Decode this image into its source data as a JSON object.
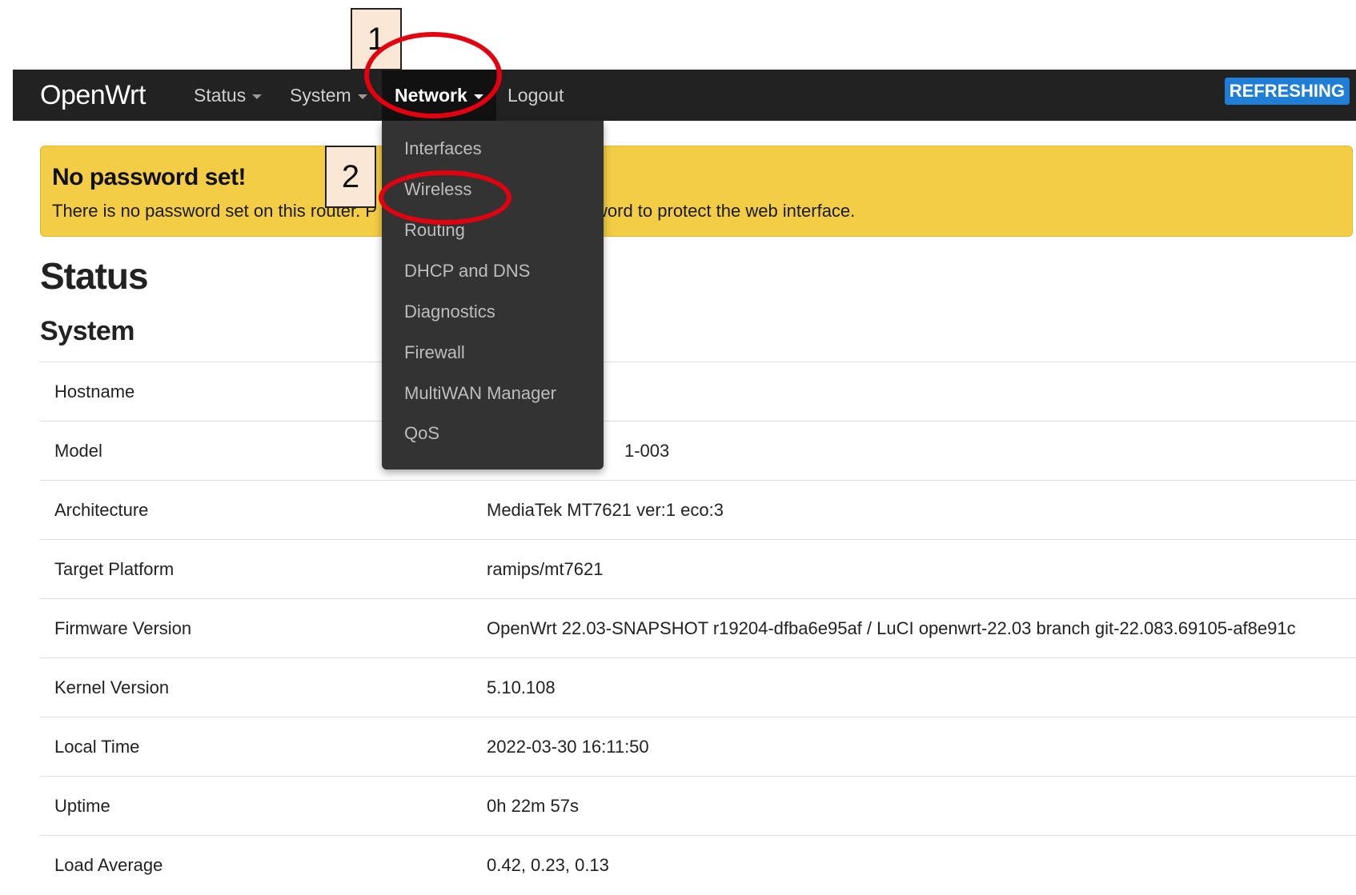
{
  "navbar": {
    "brand": "OpenWrt",
    "items": [
      {
        "label": "Status"
      },
      {
        "label": "System"
      },
      {
        "label": "Network"
      },
      {
        "label": "Logout"
      }
    ],
    "refreshing_badge": "REFRESHING"
  },
  "alert": {
    "title": "No password set!",
    "text_left": "There is no password set on this router. P",
    "text_right": "word to protect the web interface."
  },
  "page": {
    "title": "Status",
    "section": "System"
  },
  "system_table": [
    {
      "key": "Hostname",
      "value": ""
    },
    {
      "key": "Model",
      "value": "1-003"
    },
    {
      "key": "Architecture",
      "value": "MediaTek MT7621 ver:1 eco:3"
    },
    {
      "key": "Target Platform",
      "value": "ramips/mt7621"
    },
    {
      "key": "Firmware Version",
      "value": "OpenWrt 22.03-SNAPSHOT r19204-dfba6e95af / LuCI openwrt-22.03 branch git-22.083.69105-af8e91c"
    },
    {
      "key": "Kernel Version",
      "value": "5.10.108"
    },
    {
      "key": "Local Time",
      "value": "2022-03-30 16:11:50"
    },
    {
      "key": "Uptime",
      "value": "0h 22m 57s"
    },
    {
      "key": "Load Average",
      "value": "0.42, 0.23, 0.13"
    }
  ],
  "network_menu": [
    "Interfaces",
    "Wireless",
    "Routing",
    "DHCP and DNS",
    "Diagnostics",
    "Firewall",
    "MultiWAN Manager",
    "QoS"
  ],
  "annotations": [
    "1",
    "2"
  ],
  "colors": {
    "navbar": "#222222",
    "alert": "#f2cd45",
    "badge": "#1f7fd6",
    "annotation_circle": "#e3000f"
  }
}
